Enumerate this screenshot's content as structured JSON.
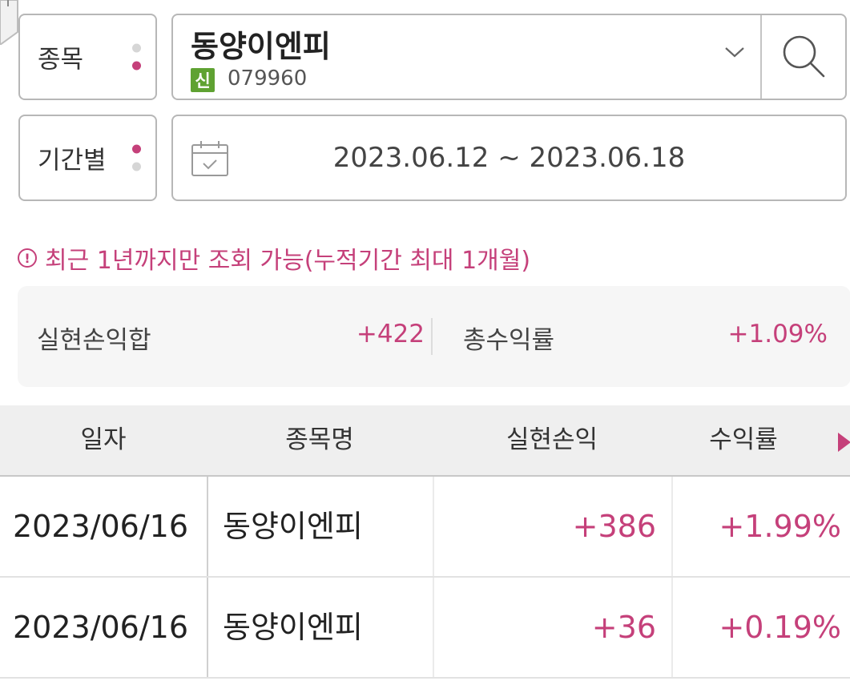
{
  "filters": {
    "stock_label": "종목",
    "stock_name": "동양이엔피",
    "badge": "신",
    "stock_code": "079960",
    "period_label": "기간별",
    "period_value": "2023.06.12 ~ 2023.06.18"
  },
  "notice": "최근 1년까지만 조회 가능(누적기간 최대 1개월)",
  "summary": {
    "realized_sum_label": "실현손익합",
    "realized_sum_value": "+422",
    "total_return_label": "총수익률",
    "total_return_value": "+1.09%"
  },
  "table": {
    "headers": [
      "일자",
      "종목명",
      "실현손익",
      "수익률"
    ],
    "rows": [
      {
        "date": "2023/06/16",
        "name": "동양이엔피",
        "pnl": "+386",
        "rate": "+1.99%"
      },
      {
        "date": "2023/06/16",
        "name": "동양이엔피",
        "pnl": "+36",
        "rate": "+0.19%"
      }
    ]
  },
  "icons": {
    "dropdown": "chevron-down-icon",
    "search": "search-icon",
    "calendar": "calendar-icon",
    "notice": "exclamation-circle-icon",
    "scroll_right": "triangle-right-icon"
  },
  "colors": {
    "accent": "#c5407a",
    "badge": "#5fa232"
  }
}
